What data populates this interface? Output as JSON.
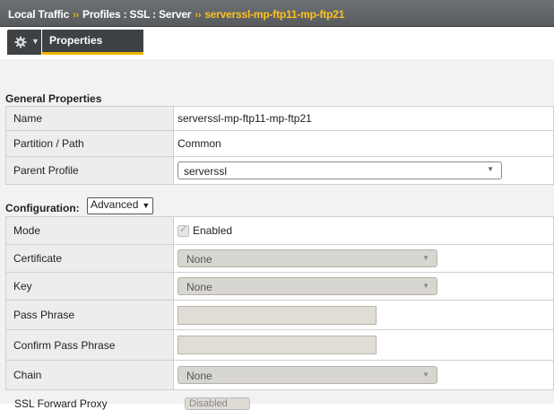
{
  "breadcrumb": {
    "part1": "Local Traffic",
    "sep1": "››",
    "part2": "Profiles : SSL : Server",
    "sep2": "››",
    "current": "serverssl-mp-ftp11-mp-ftp21"
  },
  "tabs": {
    "gear_icon": "gear-icon",
    "properties": "Properties"
  },
  "general": {
    "title": "General Properties",
    "rows": [
      {
        "label": "Name",
        "value": "serverssl-mp-ftp11-mp-ftp21"
      },
      {
        "label": "Partition / Path",
        "value": "Common"
      },
      {
        "label": "Parent Profile",
        "value": "serverssl"
      }
    ]
  },
  "configuration": {
    "title": "Configuration:",
    "mode_select": "Advanced",
    "rows": [
      {
        "label": "Mode",
        "value": "Enabled"
      },
      {
        "label": "Certificate",
        "value": "None"
      },
      {
        "label": "Key",
        "value": "None"
      },
      {
        "label": "Pass Phrase",
        "value": ""
      },
      {
        "label": "Confirm Pass Phrase",
        "value": ""
      },
      {
        "label": "Chain",
        "value": "None"
      },
      {
        "label": "SSL Forward Proxy",
        "value": "Disabled"
      }
    ]
  },
  "colors": {
    "accent": "#f0b400",
    "breadcrumb_current": "#ffc21a",
    "topbar": "#5f6265"
  }
}
